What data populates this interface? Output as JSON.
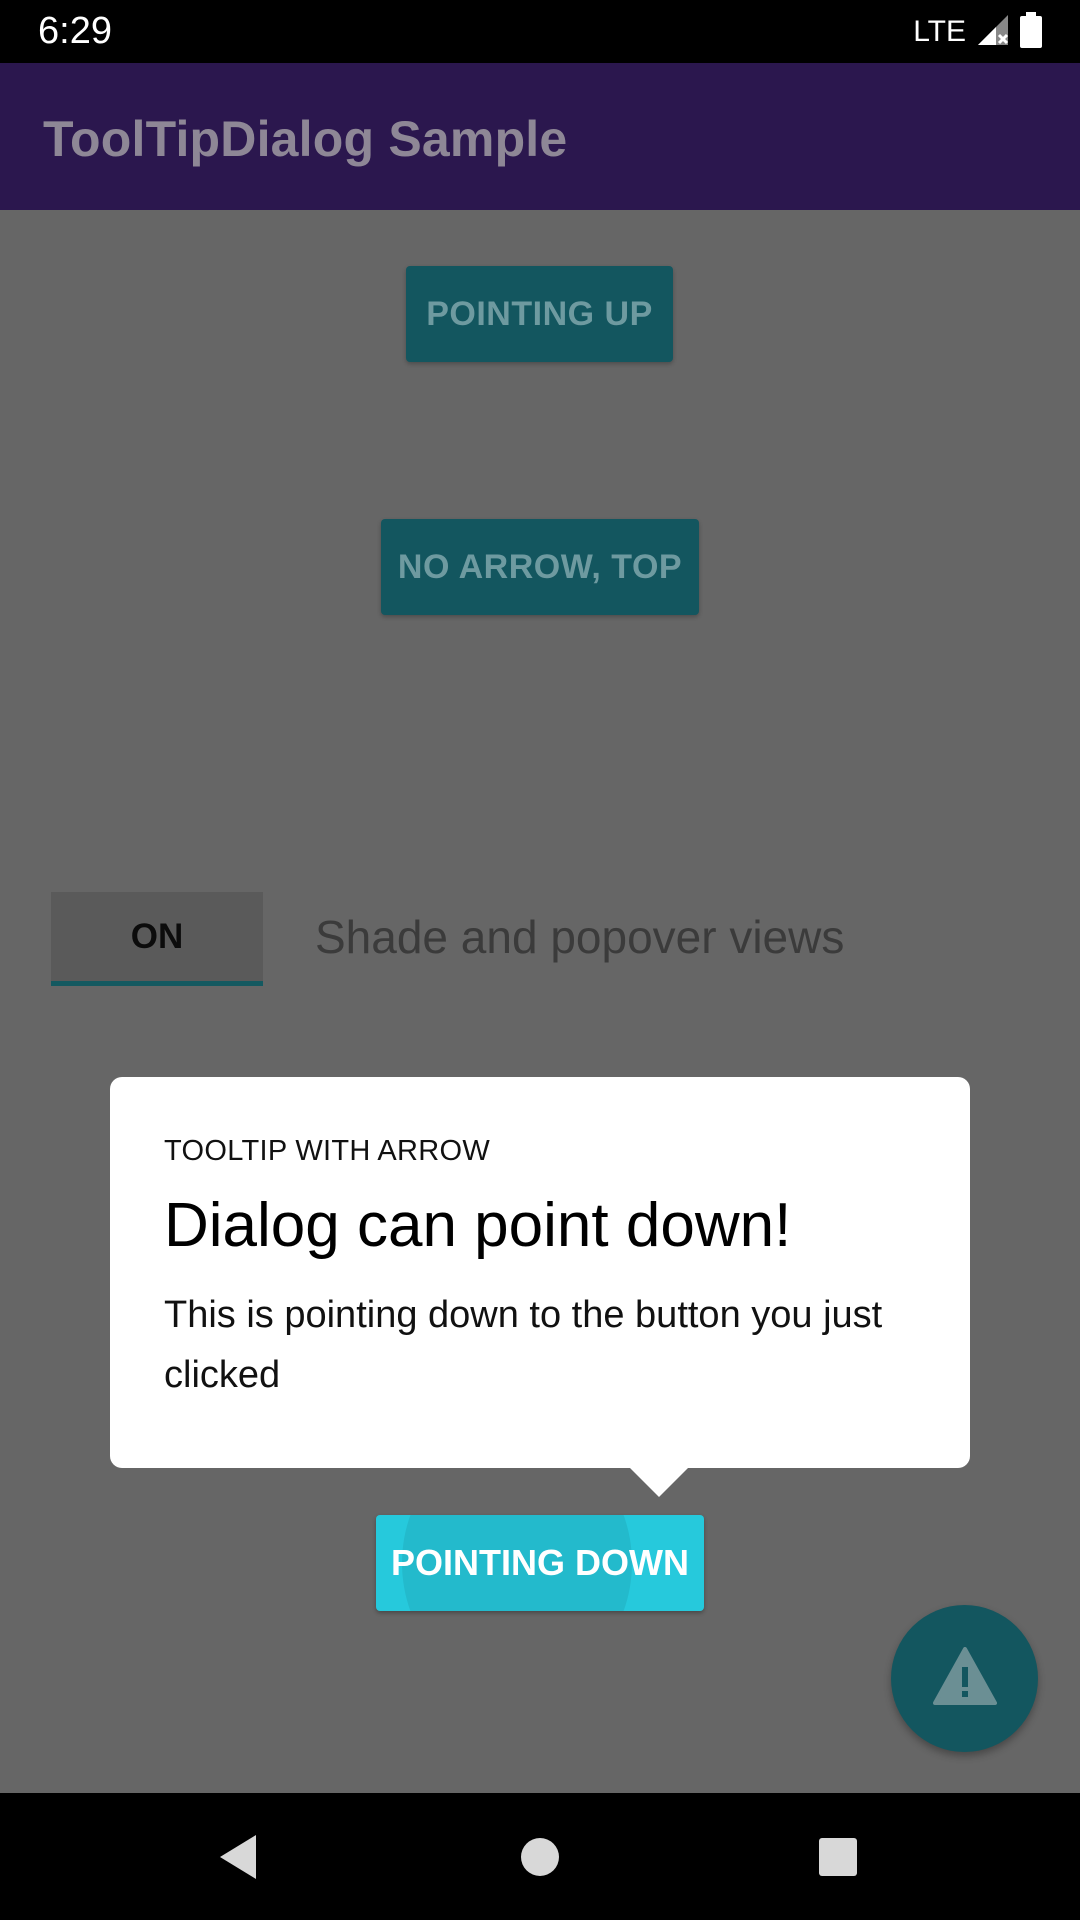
{
  "status_bar": {
    "time": "6:29",
    "network": "LTE"
  },
  "app_bar": {
    "title": "ToolTipDialog Sample"
  },
  "buttons": {
    "pointing_up": "POINTING UP",
    "no_arrow_top": "NO ARROW, TOP",
    "pointing_down": "POINTING DOWN"
  },
  "toggle": {
    "state_label": "ON",
    "label": "Shade and popover views"
  },
  "dialog": {
    "kicker": "TOOLTIP WITH ARROW",
    "title": "Dialog can point down!",
    "body": "This is pointing down to the button you just clicked"
  },
  "fab": {
    "icon": "warning-icon"
  },
  "nav_bar": {
    "icons": [
      "back-icon",
      "home-icon",
      "recents-icon"
    ]
  },
  "colors": {
    "app_bar": "#2b174e",
    "accent": "#26c9dc",
    "dimmed_button": "#13565f",
    "scrim": "#666666"
  }
}
